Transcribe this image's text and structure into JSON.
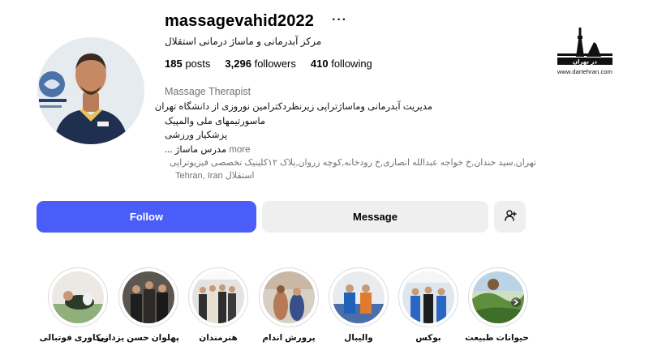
{
  "profile": {
    "username": "massagevahid2022",
    "more_icon": "ellipsis-icon",
    "subtitle": "مرکز آبدرمانی و ماساژ درمانی استقلال",
    "stats": {
      "posts_count": "185",
      "posts_label": "posts",
      "followers_count": "3,296",
      "followers_label": "followers",
      "following_count": "410",
      "following_label": "following"
    },
    "category": "Massage Therapist",
    "bio": [
      "مدیریت آبدرمانی وماساژتراپی زیرنظردکترامین نوروزی از دانشگاه تهران",
      "ماسورتیمهای ملی والمپیک",
      "پزشکیار ورزشی",
      "مدرس ماساژ ..."
    ],
    "bio_more": "more",
    "address_line1": "تهران,سید خندان,خ خواجه عبدالله انصاری,خ رودخانه,کوچه زروان,پلاک ۱۲کلینیک تخصصی فیزیوتراپی",
    "address_line2": "استقلال",
    "location": "Tehran, Iran"
  },
  "actions": {
    "follow_label": "Follow",
    "message_label": "Message",
    "add_user_icon": "person-add-icon"
  },
  "colors": {
    "follow_bg": "#4a5df9",
    "secondary_bg": "#efefef",
    "muted_text": "#737373"
  },
  "highlights": [
    {
      "label": "ریکاوری فوتبالی"
    },
    {
      "label": "پهلوان حسن یزدانی"
    },
    {
      "label": "هنرمندان"
    },
    {
      "label": "پرورش اندام"
    },
    {
      "label": "والیبال"
    },
    {
      "label": "بوکس"
    },
    {
      "label": "حیوانات طبیعت"
    }
  ],
  "logo": {
    "brand_text": "در تهران",
    "url": "www.dartehran.com"
  }
}
